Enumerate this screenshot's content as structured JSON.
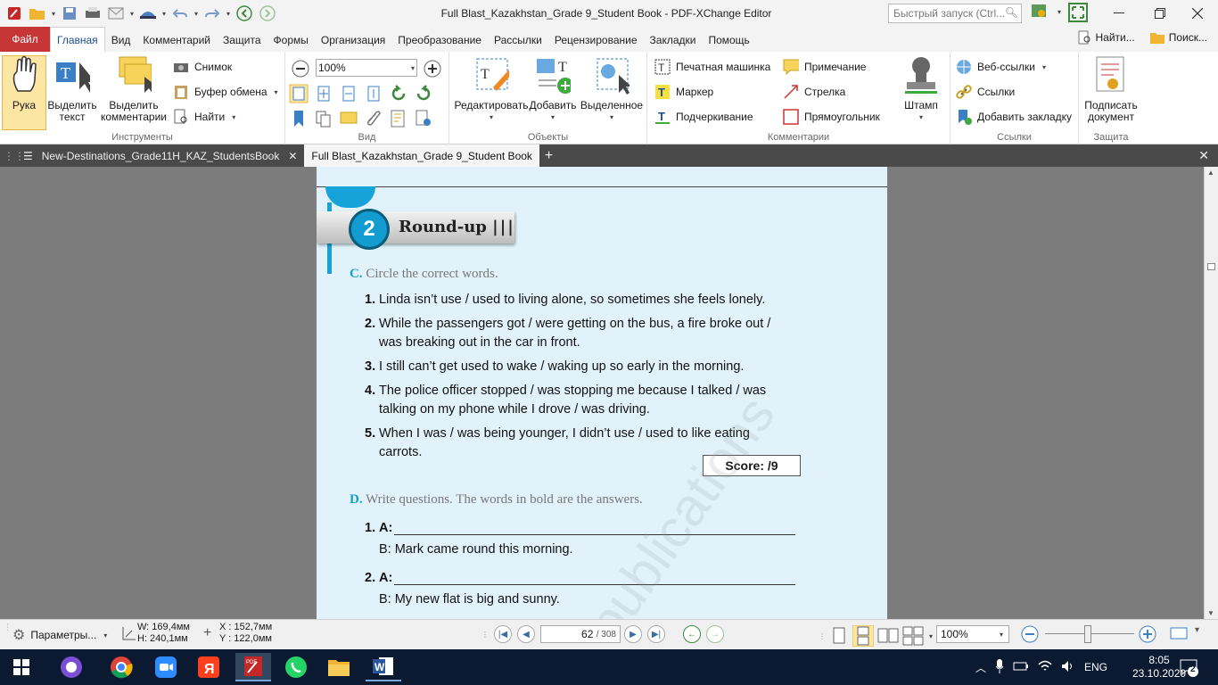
{
  "window": {
    "title": "Full Blast_Kazakhstan_Grade 9_Student Book - PDF-XChange Editor",
    "quick_launch_placeholder": "Быстрый запуск (Ctrl..."
  },
  "menu": {
    "file": "Файл",
    "items": [
      "Главная",
      "Вид",
      "Комментарий",
      "Защита",
      "Формы",
      "Организация",
      "Преобразование",
      "Рассылки",
      "Рецензирование",
      "Закладки",
      "Помощь"
    ],
    "find": "Найти...",
    "search": "Поиск..."
  },
  "ribbon": {
    "tools": {
      "hand": "Рука",
      "select_text_1": "Выделить",
      "select_text_2": "текст",
      "select_comments_1": "Выделить",
      "select_comments_2": "комментарии",
      "snapshot": "Снимок",
      "clipboard": "Буфер обмена",
      "find": "Найти",
      "label": "Инструменты"
    },
    "view": {
      "zoom": "100%",
      "label": "Вид"
    },
    "objects": {
      "edit": "Редактировать",
      "add": "Добавить",
      "selected": "Выделенное",
      "label": "Объекты"
    },
    "comments": {
      "typewriter": "Печатная машинка",
      "note": "Примечание",
      "marker": "Маркер",
      "arrow": "Стрелка",
      "underline": "Подчеркивание",
      "rectangle": "Прямоугольник",
      "stamp": "Штамп",
      "label": "Комментарии"
    },
    "links": {
      "web": "Веб-ссылки",
      "links": "Ссылки",
      "bookmark": "Добавить закладку",
      "label": "Ссылки"
    },
    "protect": {
      "sign_1": "Подписать",
      "sign_2": "документ",
      "label": "Защита"
    }
  },
  "tabs": [
    {
      "label": "New-Destinations_Grade11H_KAZ_StudentsBook"
    },
    {
      "label": "Full Blast_Kazakhstan_Grade 9_Student Book"
    }
  ],
  "doc": {
    "unit_number": "2",
    "unit_title": "Round-up",
    "secC_letter": "C.",
    "secC_title": "Circle the correct words.",
    "c_items": [
      {
        "n": "1.",
        "text": "Linda isn’t use / used to living alone, so sometimes she feels lonely."
      },
      {
        "n": "2.",
        "text": "While the passengers got / were getting on the bus, a fire broke out / was breaking out in the car in front."
      },
      {
        "n": "3.",
        "text": "I still can’t get used to wake / waking up so early in the morning."
      },
      {
        "n": "4.",
        "text": "The police officer stopped / was stopping me because I talked / was talking on my phone while I drove / was driving."
      },
      {
        "n": "5.",
        "text": "When I was / was being younger, I didn’t use / used to like eating carrots."
      }
    ],
    "score": "Score:   /9",
    "secD_letter": "D.",
    "secD_title": "Write questions. The words in bold are the answers.",
    "d_items": [
      {
        "n": "1.",
        "a": "A:",
        "b": "B: Mark came round this morning."
      },
      {
        "n": "2.",
        "a": "A:",
        "b": "B: My new flat is big and sunny."
      }
    ],
    "watermark": "publications"
  },
  "status": {
    "params": "Параметры...",
    "w": "W: 169,4мм",
    "h": "H: 240,1мм",
    "x": "X : 152,7мм",
    "y": "Y : 122,0мм",
    "page": "62",
    "total": "/ 308",
    "zoom": "100%"
  },
  "taskbar": {
    "lang": "ENG",
    "time": "8:05",
    "date": "23.10.2020",
    "notifications": "2"
  }
}
